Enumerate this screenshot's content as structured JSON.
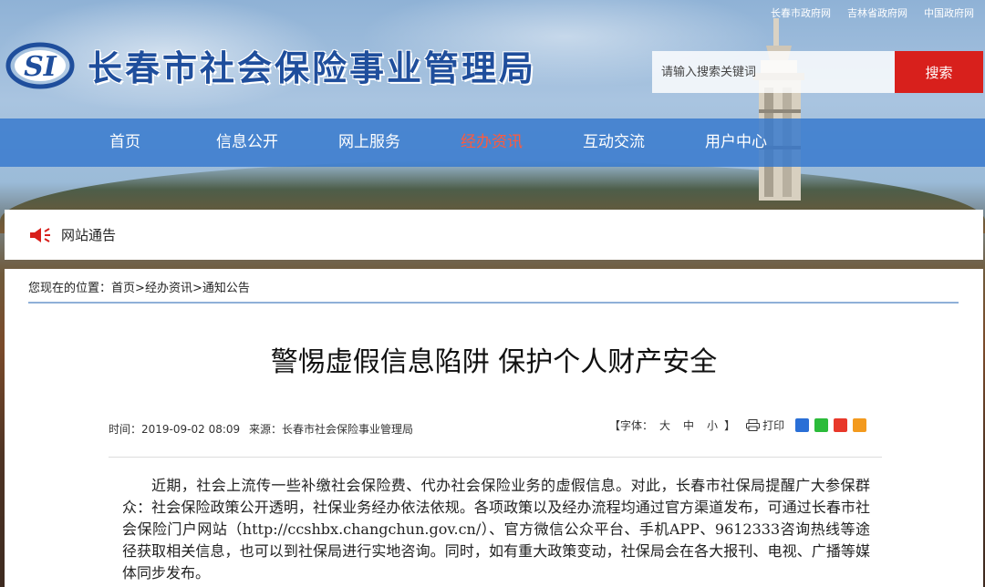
{
  "top_links": [
    "长春市政府网",
    "吉林省政府网",
    "中国政府网"
  ],
  "site": {
    "logo_text": "SI",
    "title": "长春市社会保险事业管理局"
  },
  "search": {
    "placeholder": "请输入搜索关键词",
    "button_label": "搜索"
  },
  "nav": {
    "items": [
      "首页",
      "信息公开",
      "网上服务",
      "经办资讯",
      "互动交流",
      "用户中心"
    ],
    "active": "经办资讯"
  },
  "notice": {
    "label": "网站通告"
  },
  "breadcrumb": {
    "prefix": "您现在的位置：",
    "items": [
      "首页",
      "经办资讯",
      "通知公告"
    ],
    "separator": ">"
  },
  "article": {
    "title": "警惕虚假信息陷阱 保护个人财产安全",
    "time_label": "时间：",
    "time": "2019-09-02 08:09",
    "source_label": "来源：",
    "source": "长春市社会保险事业管理局",
    "font_label": "【字体：",
    "font_sizes": [
      "大",
      "中",
      "小"
    ],
    "font_close": "】",
    "print_label": "打印",
    "share_icons": [
      "qq-icon",
      "wechat-icon",
      "weibo-icon",
      "more-share-icon"
    ],
    "body": "近期，社会上流传一些补缴社会保险费、代办社会保险业务的虚假信息。对此，长春市社保局提醒广大参保群众：社会保险政策公开透明，社保业务经办依法依规。各项政策以及经办流程均通过官方渠道发布，可通过长春市社会保险门户网站（http://ccshbx.changchun.gov.cn/）、官方微信公众平台、手机APP、9612333咨询热线等途径获取相关信息，也可以到社保局进行实地咨询。同时，如有重大政策变动，社保局会在各大报刊、电视、广播等媒体同步发布。"
  },
  "colors": {
    "brand_blue": "#1f4e9c",
    "nav_bg": "#3478cd",
    "nav_active": "#ff5a3c",
    "search_button": "#d8201c"
  }
}
